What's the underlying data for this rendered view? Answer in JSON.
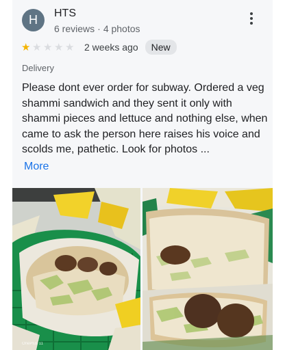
{
  "reviewer": {
    "initial": "H",
    "name": "HTS",
    "reviews": "6 reviews",
    "photos": "4 photos",
    "separator": "·"
  },
  "rating": {
    "value": 1,
    "max": 5,
    "time": "2 weeks ago",
    "badge": "New"
  },
  "service_type": "Delivery",
  "review_text": "Please dont ever order for subway. Ordered a veg shammi sandwich and they sent it only with shammi pieces and lettuce and nothing else, when came to ask the person here raises his voice and scolds me, pathetic. Look for photos ...",
  "more_label": "More",
  "photos": {
    "watermark": "OnePlus 11"
  },
  "colors": {
    "avatar": "#5f7484",
    "star_filled": "#f4b400",
    "star_empty": "#dadce0",
    "link": "#1a73e8",
    "badge_bg": "#e3e5e8"
  },
  "icons": [
    "more-vert-icon",
    "star-icon"
  ]
}
